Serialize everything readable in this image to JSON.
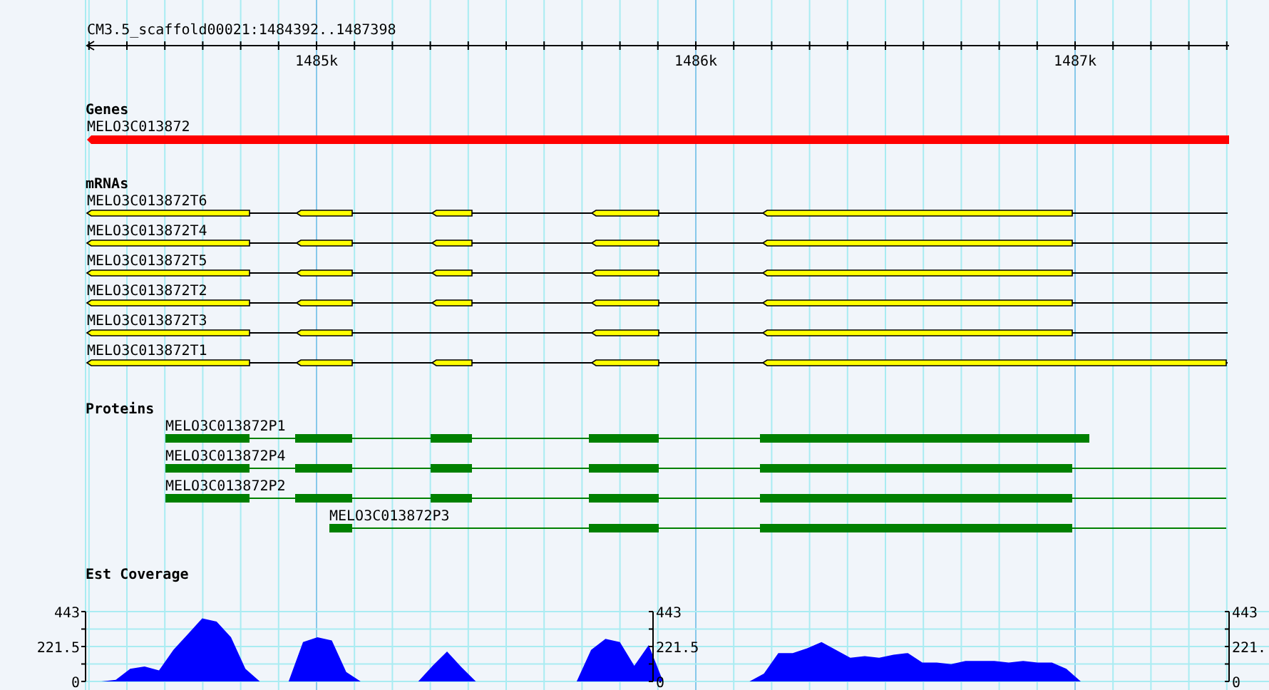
{
  "ruler": {
    "title": "CM3.5_scaffold00021:1484392..1487398",
    "ticks": [
      "1485k",
      "1486k",
      "1487k"
    ]
  },
  "genes": {
    "label": "Genes",
    "items": [
      {
        "name": "MELO3C013872"
      }
    ]
  },
  "mrnas": {
    "label": "mRNAs",
    "items": [
      {
        "name": "MELO3C013872T6"
      },
      {
        "name": "MELO3C013872T4"
      },
      {
        "name": "MELO3C013872T5"
      },
      {
        "name": "MELO3C013872T2"
      },
      {
        "name": "MELO3C013872T3"
      },
      {
        "name": "MELO3C013872T1"
      }
    ]
  },
  "proteins": {
    "label": "Proteins",
    "items": [
      {
        "name": "MELO3C013872P1"
      },
      {
        "name": "MELO3C013872P4"
      },
      {
        "name": "MELO3C013872P2"
      },
      {
        "name": "MELO3C013872P3"
      }
    ]
  },
  "coverage": {
    "label": "Est Coverage",
    "extra_axes": [
      {
        "labels": [
          "443",
          "221.5",
          "0"
        ]
      },
      {
        "labels": [
          "443",
          "221.",
          "0"
        ]
      }
    ],
    "chart_data": {
      "type": "area",
      "ylim": [
        0,
        443
      ],
      "yticks": [
        {
          "value": 0,
          "label": "0"
        },
        {
          "value": 221.5,
          "label": "221.5"
        },
        {
          "value": 443,
          "label": "443"
        }
      ],
      "categories": [
        null,
        null,
        null,
        null,
        null,
        null,
        null,
        null,
        null,
        null,
        null,
        null,
        null,
        null,
        null,
        null,
        null,
        null,
        null,
        null,
        null,
        null,
        null,
        null,
        null,
        null,
        null,
        null,
        null,
        null,
        null,
        null,
        null,
        null,
        null,
        null,
        null,
        null,
        null,
        null,
        null,
        null,
        null,
        null,
        null,
        null,
        null,
        null,
        null,
        null,
        null,
        null,
        null,
        null,
        null,
        null,
        null,
        null,
        null,
        null,
        null,
        null,
        null,
        null,
        null,
        null,
        null,
        null,
        null,
        null,
        null,
        null,
        null,
        null,
        null,
        null,
        null,
        null,
        null,
        null
      ],
      "series": [
        {
          "color": "#0000ff",
          "values": [
            0,
            0,
            10,
            80,
            95,
            70,
            200,
            300,
            400,
            380,
            280,
            80,
            0,
            0,
            0,
            250,
            280,
            260,
            60,
            0,
            0,
            0,
            0,
            0,
            100,
            190,
            90,
            0,
            0,
            0,
            0,
            0,
            0,
            0,
            0,
            200,
            270,
            250,
            100,
            230,
            0,
            0,
            0,
            0,
            0,
            0,
            0,
            50,
            180,
            180,
            210,
            250,
            200,
            150,
            160,
            150,
            170,
            180,
            120,
            120,
            110,
            130,
            130,
            130,
            120,
            130,
            120,
            120,
            80,
            0,
            0,
            0,
            0,
            0,
            0,
            0,
            0,
            0,
            0,
            0
          ]
        }
      ]
    }
  }
}
